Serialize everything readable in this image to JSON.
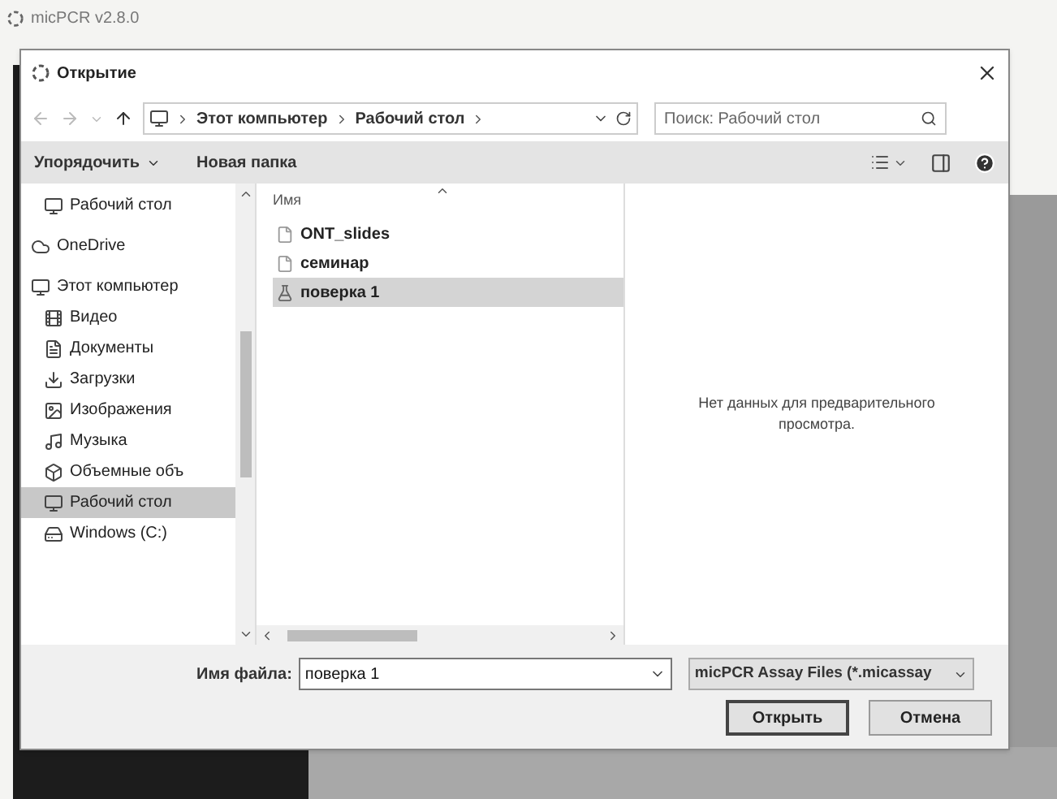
{
  "app_title": "micPCR v2.8.0",
  "dialog": {
    "title": "Открытие",
    "address": {
      "segments": [
        "Этот компьютер",
        "Рабочий стол"
      ]
    },
    "search": {
      "placeholder": "Поиск: Рабочий стол"
    },
    "toolbar": {
      "organize": "Упорядочить",
      "new_folder": "Новая папка"
    },
    "sidebar": [
      {
        "label": "Рабочий стол",
        "selected": false
      },
      {
        "label": "OneDrive",
        "selected": false
      },
      {
        "label": "Этот компьютер",
        "selected": false,
        "children": [
          {
            "label": "Видео",
            "selected": false
          },
          {
            "label": "Документы",
            "selected": false
          },
          {
            "label": "Загрузки",
            "selected": false
          },
          {
            "label": "Изображения",
            "selected": false
          },
          {
            "label": "Музыка",
            "selected": false
          },
          {
            "label": "Объемные объ",
            "selected": false
          },
          {
            "label": "Рабочий стол",
            "selected": true
          },
          {
            "label": "Windows (C:)",
            "selected": false
          }
        ]
      }
    ],
    "file_list": {
      "column": "Имя",
      "files": [
        {
          "name": "ONT_slides",
          "kind": "doc",
          "selected": false
        },
        {
          "name": "семинар",
          "kind": "doc",
          "selected": false
        },
        {
          "name": "поверка 1",
          "kind": "assay",
          "selected": true
        }
      ]
    },
    "preview": "Нет данных для предварительного просмотра.",
    "filename_label": "Имя файла:",
    "filename_value": "поверка 1",
    "filter": "micPCR Assay Files (*.micassay",
    "buttons": [
      "Открыть",
      "Отмена"
    ]
  }
}
